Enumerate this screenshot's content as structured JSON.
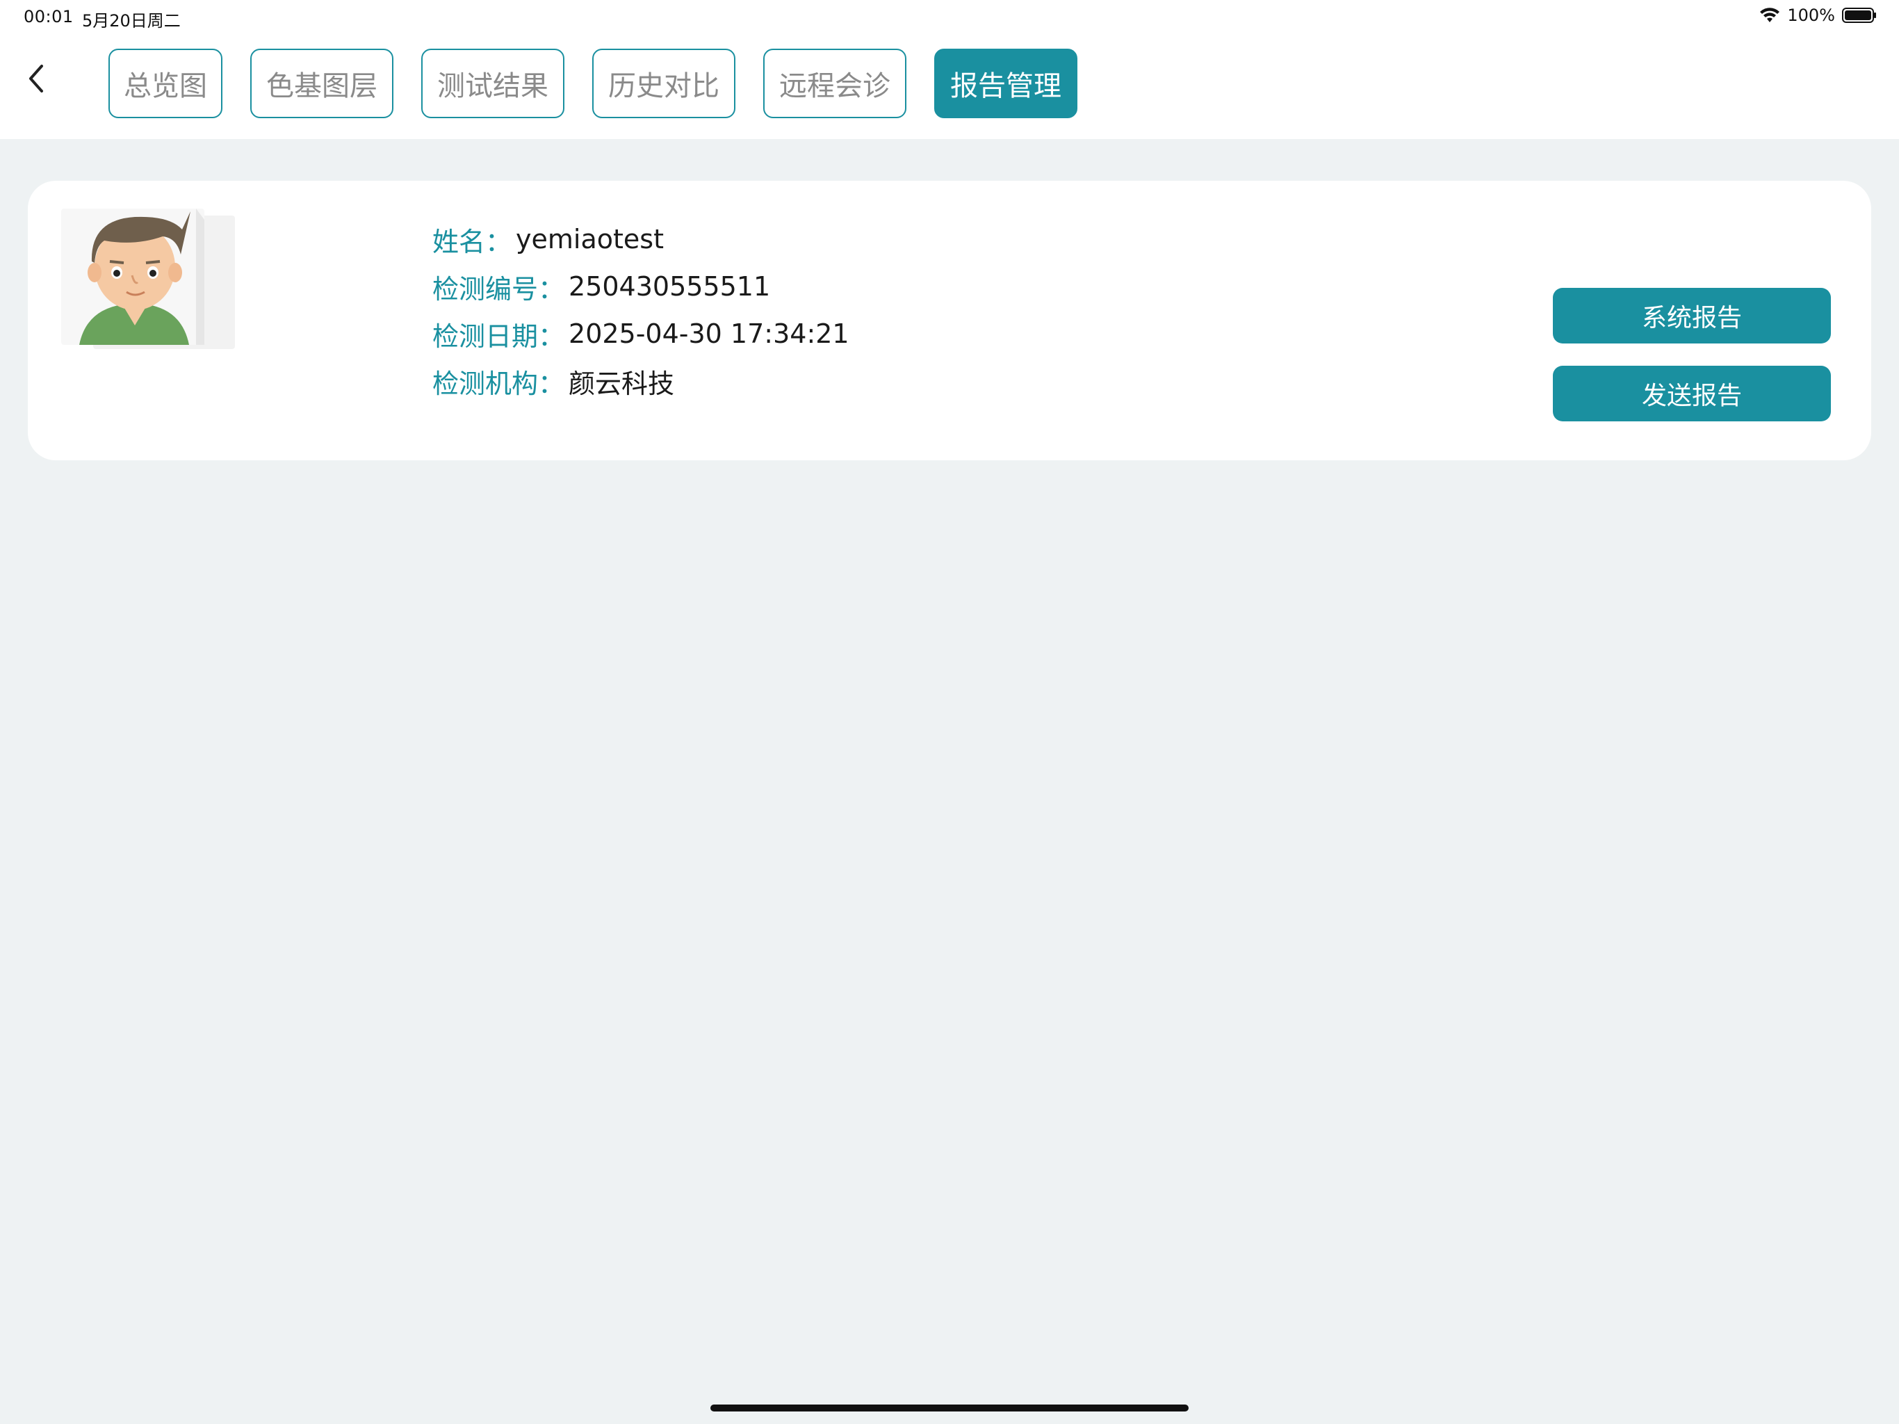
{
  "status_bar": {
    "time": "00:01",
    "date": "5月20日周二",
    "battery": "100%",
    "icons": [
      "wifi-icon",
      "battery-icon"
    ]
  },
  "nav": {
    "back_icon": "chevron-left-icon",
    "tabs": [
      {
        "label": "总览图",
        "active": false
      },
      {
        "label": "色基图层",
        "active": false
      },
      {
        "label": "测试结果",
        "active": false
      },
      {
        "label": "历史对比",
        "active": false
      },
      {
        "label": "远程会诊",
        "active": false
      },
      {
        "label": "报告管理",
        "active": true
      }
    ]
  },
  "profile": {
    "name_label": "姓名：",
    "name_value": "yemiaotest",
    "id_label": "检测编号：",
    "id_value": "250430555511",
    "date_label": "检测日期：",
    "date_value": "2025-04-30 17:34:21",
    "org_label": "检测机构：",
    "org_value": "颜云科技"
  },
  "actions": {
    "system_report": "系统报告",
    "send_report": "发送报告"
  },
  "colors": {
    "accent": "#1a90a0",
    "background": "#eef2f3"
  }
}
